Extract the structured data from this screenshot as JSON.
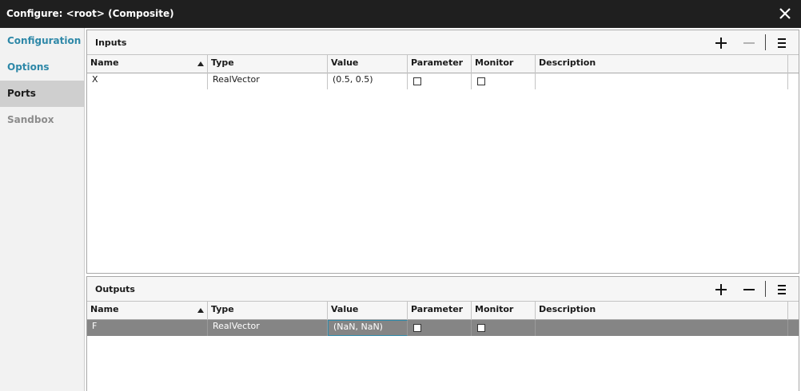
{
  "window": {
    "title": "Configure: <root> (Composite)"
  },
  "sidebar": {
    "items": [
      {
        "label": "Configuration"
      },
      {
        "label": "Options"
      },
      {
        "label": "Ports"
      },
      {
        "label": "Sandbox"
      }
    ]
  },
  "columns": {
    "name": "Name",
    "type": "Type",
    "value": "Value",
    "parameter": "Parameter",
    "monitor": "Monitor",
    "description": "Description"
  },
  "inputs": {
    "title": "Inputs",
    "rows": [
      {
        "name": "X",
        "type": "RealVector",
        "value": "(0.5, 0.5)",
        "description": ""
      }
    ]
  },
  "outputs": {
    "title": "Outputs",
    "rows": [
      {
        "name": "F",
        "type": "RealVector",
        "value": "(NaN, NaN)",
        "description": ""
      }
    ]
  },
  "colors": {
    "titlebar": "#1f1f1f",
    "accent": "#2e88a8",
    "selected_row": "#858585"
  }
}
